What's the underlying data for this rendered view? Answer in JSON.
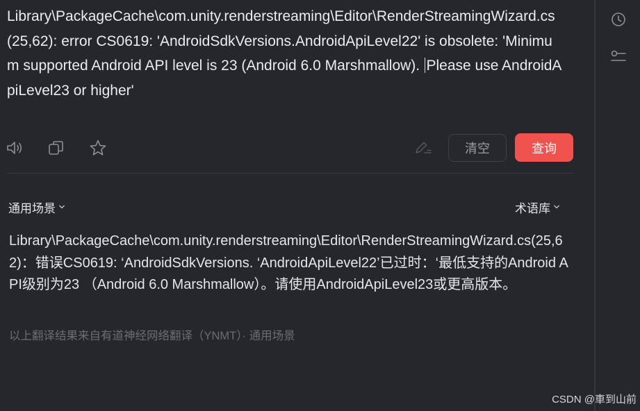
{
  "source": {
    "text_before_caret": "Library\\PackageCache\\com.unity.renderstreaming\\Editor\\RenderStreamingWizard.cs(25,62): error CS0619: 'AndroidSdkVersions.AndroidApiLevel22' is obsolete: 'Minimum supported Android API level is 23 (Android 6.0 Marshmallow).",
    "text_after_caret": "Please use AndroidApiLevel23 or higher'"
  },
  "toolbar": {
    "speak_icon": "speaker-icon",
    "copy_icon": "copy-icon",
    "favorite_icon": "star-icon",
    "edit_icon": "edit-icon",
    "clear_label": "清空",
    "query_label": "查询",
    "query_color": "#f0524d"
  },
  "options": {
    "scene_label": "通用场景",
    "termbase_label": "术语库"
  },
  "result": {
    "text": "Library\\PackageCache\\com.unity.renderstreaming\\Editor\\RenderStreamingWizard.cs(25,62)：错误CS0619: ‘AndroidSdkVersions. ‘AndroidApiLevel22’已过时：‘最低支持的Android API级别为23 （Android 6.0 Marshmallow）。请使用AndroidApiLevel23或更高版本。",
    "attribution": "以上翻译结果来自有道神经网络翻译（YNMT）· 通用场景"
  },
  "sidebar": {
    "history_icon": "history-clock-icon",
    "settings_icon": "slider-settings-icon"
  },
  "watermark": "CSDN @車到山前"
}
